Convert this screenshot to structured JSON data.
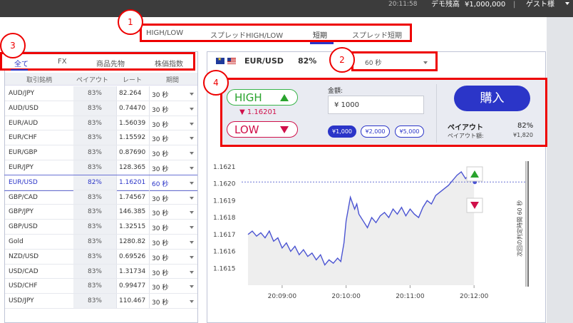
{
  "topbar": {
    "time": "20:11:58",
    "balance_label": "デモ残高",
    "balance_value": "¥1,000,000",
    "separator": "|",
    "user": "ゲスト様"
  },
  "trade_types": {
    "tabs": [
      "HIGH/LOW",
      "スプレッドHIGH/LOW",
      "短期",
      "スプレッド短期"
    ],
    "active_index": 2
  },
  "callouts": [
    "1",
    "2",
    "3",
    "4"
  ],
  "categories": {
    "tabs": [
      "全て",
      "FX",
      "商品先物",
      "株価指数"
    ],
    "active_index": 0
  },
  "table": {
    "headers": [
      "取引銘柄",
      "ペイアウト",
      "レート",
      "期間"
    ],
    "rows": [
      {
        "name": "AUD/JPY",
        "payout": "83%",
        "rate": "82.264",
        "period": "30 秒"
      },
      {
        "name": "AUD/USD",
        "payout": "83%",
        "rate": "0.74470",
        "period": "30 秒"
      },
      {
        "name": "EUR/AUD",
        "payout": "83%",
        "rate": "1.56039",
        "period": "30 秒"
      },
      {
        "name": "EUR/CHF",
        "payout": "83%",
        "rate": "1.15592",
        "period": "30 秒"
      },
      {
        "name": "EUR/GBP",
        "payout": "83%",
        "rate": "0.87690",
        "period": "30 秒"
      },
      {
        "name": "EUR/JPY",
        "payout": "83%",
        "rate": "128.365",
        "period": "30 秒"
      },
      {
        "name": "EUR/USD",
        "payout": "82%",
        "rate": "1.16201",
        "period": "60 秒",
        "selected": true
      },
      {
        "name": "GBP/CAD",
        "payout": "83%",
        "rate": "1.74567",
        "period": "30 秒"
      },
      {
        "name": "GBP/JPY",
        "payout": "83%",
        "rate": "146.385",
        "period": "30 秒"
      },
      {
        "name": "GBP/USD",
        "payout": "83%",
        "rate": "1.32515",
        "period": "30 秒"
      },
      {
        "name": "Gold",
        "payout": "83%",
        "rate": "1280.82",
        "period": "30 秒"
      },
      {
        "name": "NZD/USD",
        "payout": "83%",
        "rate": "0.69526",
        "period": "30 秒"
      },
      {
        "name": "USD/CAD",
        "payout": "83%",
        "rate": "1.31734",
        "period": "30 秒"
      },
      {
        "name": "USD/CHF",
        "payout": "83%",
        "rate": "0.99477",
        "period": "30 秒"
      },
      {
        "name": "USD/JPY",
        "payout": "83%",
        "rate": "110.467",
        "period": "30 秒"
      }
    ]
  },
  "asset": {
    "name": "EUR/USD",
    "payout": "82%",
    "period_value": "60 秒"
  },
  "trade": {
    "high_label": "HIGH",
    "low_label": "LOW",
    "current_rate": "▼ 1.16201",
    "amount_label": "金額:",
    "amount_value": "¥ 1000",
    "chips": [
      {
        "label": "¥1,000",
        "active": true
      },
      {
        "label": "¥2,000",
        "active": false
      },
      {
        "label": "¥5,000",
        "active": false
      }
    ],
    "buy_label": "購入",
    "payout_title": "ペイアウト",
    "payout_pct": "82%",
    "payout_amount_label": "ペイアウト額:",
    "payout_amount": "¥1,820"
  },
  "colors": {
    "accent": "#2b35c8",
    "high": "#2aa32e",
    "low": "#d0104a",
    "callout": "#ee0000"
  },
  "chart_data": {
    "type": "line",
    "ylim": [
      1.1614,
      1.16215
    ],
    "yticks": [
      "1.1621",
      "1.1620",
      "1.1619",
      "1.1618",
      "1.1617",
      "1.1616",
      "1.1615"
    ],
    "ytick_values": [
      1.1621,
      1.162,
      1.1619,
      1.1618,
      1.1617,
      1.1616,
      1.1615
    ],
    "xticks": [
      "20:09:00",
      "20:10:00",
      "20:11:00",
      "20:12:00"
    ],
    "xtick_seconds": [
      540,
      600,
      660,
      720
    ],
    "xlim_seconds": [
      506,
      768
    ],
    "current_price": 1.16201,
    "vertical_label": "次回の判定時間 60 秒",
    "series": [
      {
        "x": [
          508,
          512,
          516,
          520,
          524,
          528,
          532,
          536,
          540,
          544,
          548,
          552,
          556,
          560,
          564,
          568,
          572,
          576,
          580,
          584,
          588,
          592,
          595,
          598,
          600,
          604,
          608,
          610,
          612,
          616,
          620,
          624,
          628,
          632,
          636,
          640,
          644,
          648,
          652,
          656,
          660,
          664,
          668,
          672,
          676,
          680,
          684,
          688,
          692,
          696,
          700,
          704,
          708,
          712,
          716,
          718,
          720
        ],
        "y": [
          1.1617,
          1.16172,
          1.16169,
          1.16171,
          1.16168,
          1.16172,
          1.16166,
          1.16168,
          1.16162,
          1.16165,
          1.1616,
          1.16163,
          1.16158,
          1.16161,
          1.16157,
          1.16159,
          1.16155,
          1.16158,
          1.16152,
          1.16155,
          1.16153,
          1.16156,
          1.16154,
          1.16165,
          1.16178,
          1.16192,
          1.16185,
          1.16188,
          1.16182,
          1.16178,
          1.16174,
          1.1618,
          1.16177,
          1.16181,
          1.16183,
          1.1618,
          1.16185,
          1.16182,
          1.16186,
          1.16181,
          1.16185,
          1.16182,
          1.1618,
          1.16186,
          1.1619,
          1.16188,
          1.16193,
          1.16195,
          1.16197,
          1.16199,
          1.16202,
          1.16205,
          1.16207,
          1.16203,
          1.16206,
          1.16203,
          1.16201
        ]
      }
    ]
  }
}
